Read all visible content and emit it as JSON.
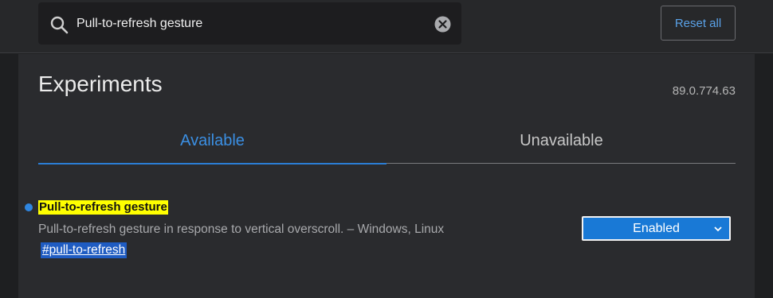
{
  "search": {
    "value": "Pull-to-refresh gesture",
    "icon": "search-icon",
    "clear_icon": "clear-icon"
  },
  "header": {
    "reset_label": "Reset all"
  },
  "page": {
    "title": "Experiments",
    "version": "89.0.774.63"
  },
  "tabs": [
    {
      "label": "Available",
      "active": true
    },
    {
      "label": "Unavailable",
      "active": false
    }
  ],
  "experiment": {
    "title": "Pull-to-refresh gesture",
    "description": "Pull-to-refresh gesture in response to vertical overscroll. – Windows, Linux",
    "link": "#pull-to-refresh",
    "selected_option": "Enabled"
  },
  "colors": {
    "accent": "#2b7ed6",
    "highlight": "#ffff00",
    "select_bg": "#1979d6",
    "background": "#1e1f21",
    "panel": "#2a2b2e"
  }
}
